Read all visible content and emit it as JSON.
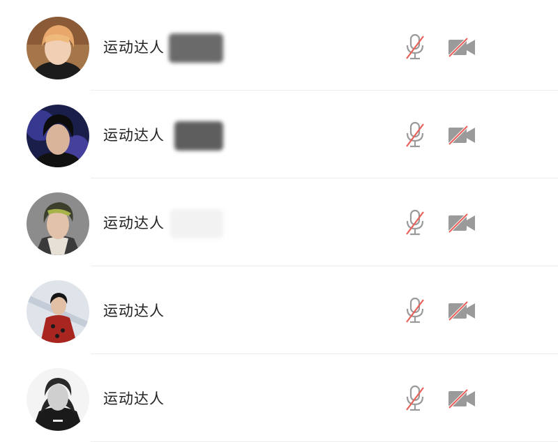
{
  "participants": [
    {
      "name": "运动达人",
      "avatar": "avatar-1",
      "mic_muted": true,
      "camera_off": true
    },
    {
      "name": "运动达人",
      "avatar": "avatar-2",
      "mic_muted": true,
      "camera_off": true
    },
    {
      "name": "运动达人",
      "avatar": "avatar-3",
      "mic_muted": true,
      "camera_off": true
    },
    {
      "name": "运动达人",
      "avatar": "avatar-4",
      "mic_muted": true,
      "camera_off": true
    },
    {
      "name": "运动达人",
      "avatar": "avatar-5",
      "mic_muted": true,
      "camera_off": true
    }
  ],
  "icons": {
    "mic": "microphone-muted-icon",
    "camera": "camera-off-icon"
  },
  "colors": {
    "icon_gray": "#9a9a9a",
    "slash_red": "#e8605a",
    "divider": "#ececec",
    "text": "#222222"
  }
}
